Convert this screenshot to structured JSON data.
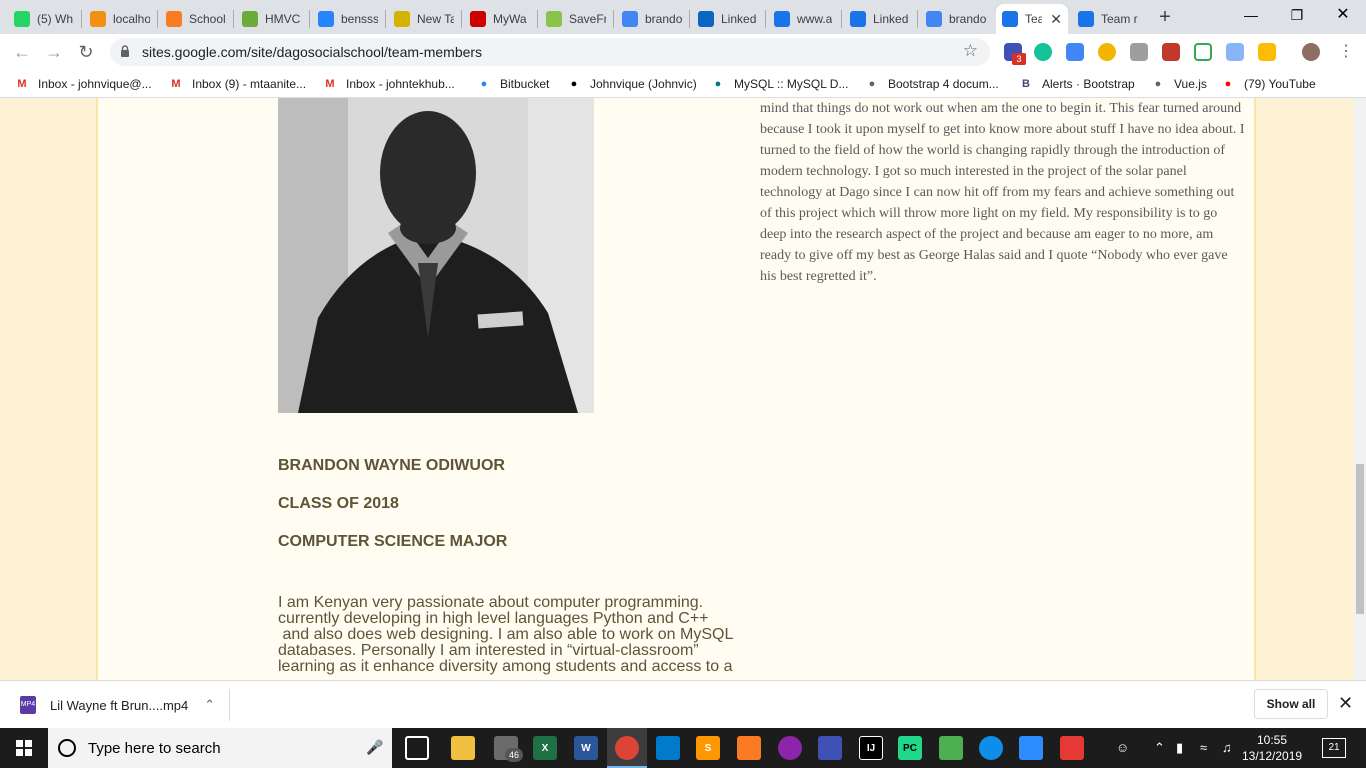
{
  "browser": {
    "tabs": [
      {
        "title": "(5) Wh",
        "icon": "whatsapp-icon",
        "color": "#25d366"
      },
      {
        "title": "localho",
        "icon": "phpmyadmin-icon",
        "color": "#f29111"
      },
      {
        "title": "School",
        "icon": "xampp-icon",
        "color": "#fb7a24"
      },
      {
        "title": "HMVC",
        "icon": "leaf-icon",
        "color": "#6cac3a"
      },
      {
        "title": "bensss",
        "icon": "bitbucket-icon",
        "color": "#2684ff"
      },
      {
        "title": "New Ta",
        "icon": "newtab-icon",
        "color": "#d4b300"
      },
      {
        "title": "MyWa",
        "icon": "mw-icon",
        "color": "#cc0000"
      },
      {
        "title": "SaveFr",
        "icon": "savefrom-icon",
        "color": "#8bc34a"
      },
      {
        "title": "brando",
        "icon": "google-icon",
        "color": "#4285f4"
      },
      {
        "title": "Linked",
        "icon": "linkedin-icon",
        "color": "#0a66c2"
      },
      {
        "title": "www.a",
        "icon": "loading-icon",
        "color": "#1a73e8"
      },
      {
        "title": "Linked",
        "icon": "loading-icon",
        "color": "#1a73e8"
      },
      {
        "title": "brando",
        "icon": "google-icon",
        "color": "#4285f4"
      },
      {
        "title": "Tea",
        "icon": "sites-icon",
        "color": "#1a73e8"
      },
      {
        "title": "Team r",
        "icon": "sites-icon",
        "color": "#1a73e8"
      }
    ],
    "new_tab_label": "+",
    "url": "sites.google.com/site/dagosocialschool/team-members",
    "extension_badge": "3"
  },
  "bookmarks": [
    {
      "label": "Inbox - johnvique@...",
      "icon": "gmail-icon"
    },
    {
      "label": "Inbox (9) - mtaanite...",
      "icon": "gmail-icon"
    },
    {
      "label": "Inbox - johntekhub...",
      "icon": "gmail-icon"
    },
    {
      "label": "Bitbucket",
      "icon": "bitbucket-icon"
    },
    {
      "label": "Johnvique (Johnvic)",
      "icon": "github-icon"
    },
    {
      "label": "MySQL :: MySQL D...",
      "icon": "mysql-icon"
    },
    {
      "label": "Bootstrap 4 docum...",
      "icon": "search-doc-icon"
    },
    {
      "label": "Alerts · Bootstrap",
      "icon": "bootstrap-icon"
    },
    {
      "label": "Vue.js",
      "icon": "globe-icon"
    },
    {
      "label": "(79) YouTube",
      "icon": "youtube-icon"
    }
  ],
  "page": {
    "right_column_text": "mind that things do not work out when am the one to begin it. This fear turned around because I took it upon myself to get into know more about stuff I have no idea about. I turned to the field of how the world is changing rapidly through the introduction of modern technology. I got so much interested in the project of the solar panel technology at Dago since I can now hit off from my fears and achieve something out of this project which will throw more light on my field. My responsibility is to go deep into the research aspect of the project and because am eager to no more, am ready to give off my best as George Halas said and I quote “Nobody who ever gave his best regretted it”.",
    "member_name": "BRANDON WAYNE ODIWUOR",
    "member_class": "CLASS OF 2018",
    "member_major": "COMPUTER SCIENCE MAJOR",
    "member_bio_lines": [
      "I am Kenyan very passionate about computer programming.",
      "currently developing in high level languages Python and C++",
      " and also does web designing. I am also able to work on MySQL",
      "databases. Personally I am interested in “virtual-classroom”",
      "learning as it enhance diversity among students and access to a"
    ]
  },
  "downloads": {
    "file_name": "Lil Wayne ft Brun....mp4",
    "file_type": "MP4",
    "show_all_label": "Show all"
  },
  "taskbar": {
    "search_placeholder": "Type here to search",
    "mail_badge": "46",
    "time": "10:55",
    "date": "13/12/2019",
    "notifications": "21"
  }
}
